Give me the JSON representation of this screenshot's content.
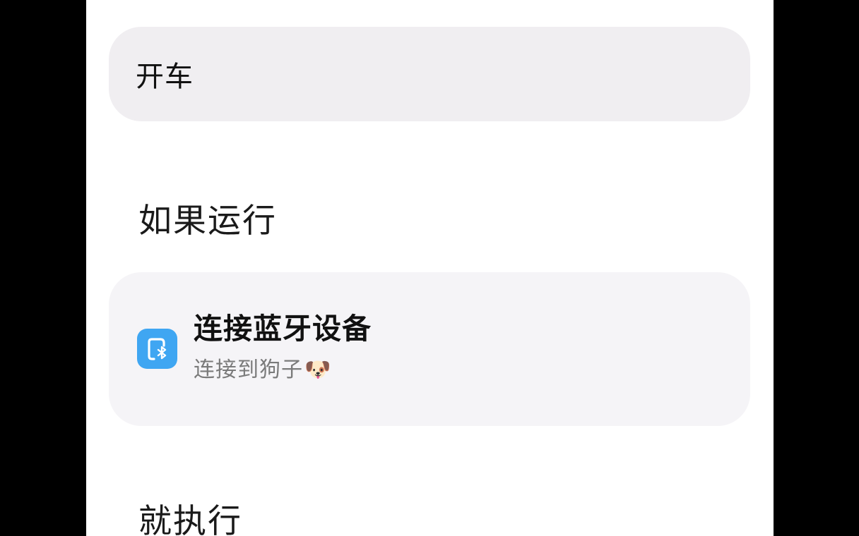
{
  "scene": {
    "name_value": "开车"
  },
  "if_section": {
    "label": "如果运行",
    "condition": {
      "icon": "bluetooth-device-icon",
      "icon_color": "#3fa6f2",
      "title": "连接蓝牙设备",
      "subtitle_text": "连接到狗子",
      "subtitle_emoji": "🐶"
    }
  },
  "then_section": {
    "label": "就执行"
  },
  "colors": {
    "background": "#000000",
    "screen": "#ffffff",
    "field": "#f0eef1",
    "card": "#f5f4f7"
  }
}
